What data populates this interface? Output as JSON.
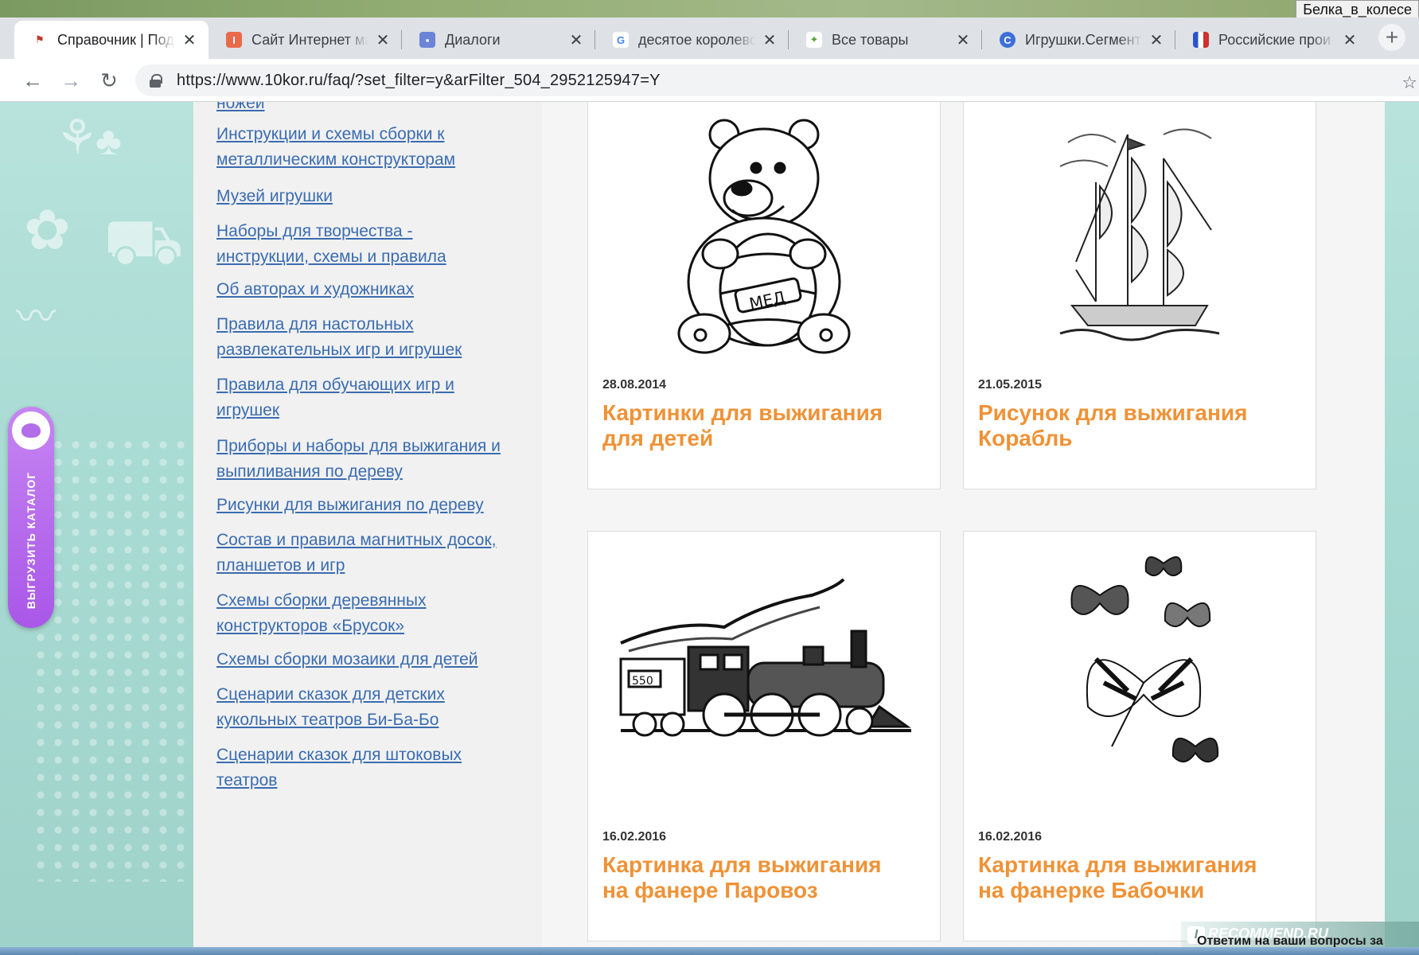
{
  "browser": {
    "user_badge": "Белка_в_колесе",
    "tabs": [
      {
        "title": "Справочник | Под",
        "active": true,
        "favicon_color": "#ffffff",
        "favicon_glyph": "⚑",
        "favicon_icon": "shield-icon"
      },
      {
        "title": "Сайт Интернет ма",
        "active": false,
        "favicon_color": "#e86a4a",
        "favicon_glyph": "I",
        "favicon_icon": "site-icon"
      },
      {
        "title": "Диалоги",
        "active": false,
        "favicon_color": "#6b84d8",
        "favicon_glyph": "▪",
        "favicon_icon": "chat-icon"
      },
      {
        "title": "десятое королевс",
        "active": false,
        "favicon_color": "#ffffff",
        "favicon_glyph": "G",
        "favicon_icon": "google-icon"
      },
      {
        "title": "Все товары",
        "active": false,
        "favicon_color": "#ffffff",
        "favicon_glyph": "✦",
        "favicon_icon": "leaf-icon"
      },
      {
        "title": "Игрушки.Сегмент",
        "active": false,
        "favicon_color": "#3f6fd8",
        "favicon_glyph": "C",
        "favicon_icon": "segment-icon"
      },
      {
        "title": "Российские прои",
        "active": false,
        "favicon_color": "#ffffff",
        "favicon_glyph": "▮",
        "favicon_icon": "bar-chart-icon"
      }
    ],
    "close_glyph": "✕",
    "new_tab_glyph": "+",
    "url": "https://www.10kor.ru/faq/?set_filter=y&arFilter_504_2952125947=Y",
    "back_glyph": "←",
    "forward_glyph": "→",
    "reload_glyph": "↻",
    "star_glyph": "☆"
  },
  "sidebar": {
    "cut_item": "ножей",
    "items": [
      {
        "line1": "Инструкции и схемы сборки к",
        "line2": "металлическим конструкторам"
      },
      {
        "line1": "Музей игрушки",
        "line2": ""
      },
      {
        "line1": "Наборы для творчества -",
        "line2": "инструкции, схемы и правила"
      },
      {
        "line1": "Об авторах и художниках",
        "line2": ""
      },
      {
        "line1": "Правила для настольных",
        "line2": "развлекательных игр и игрушек"
      },
      {
        "line1": "Правила для обучающих игр и",
        "line2": "игрушек"
      },
      {
        "line1": "Приборы и наборы для выжигания и",
        "line2": "выпиливания по дереву"
      },
      {
        "line1": "Рисунки для выжигания по дереву",
        "line2": ""
      },
      {
        "line1": "Состав и правила магнитных досок,",
        "line2": "планшетов и игр"
      },
      {
        "line1": "Схемы сборки деревянных",
        "line2": "конструкторов «Брусок»"
      },
      {
        "line1": "Схемы сборки мозаики для детей",
        "line2": ""
      },
      {
        "line1": "Сценарии сказок для детских",
        "line2": "кукольных театров Би-Ба-Бо"
      },
      {
        "line1": "Сценарии сказок для штоковых",
        "line2": "театров"
      }
    ]
  },
  "cards": [
    {
      "date": "28.08.2014",
      "title_line1": "Картинки для выжигания",
      "title_line2": "для детей",
      "image": "bear-with-honey-barrel",
      "barrel_text": "МЕД"
    },
    {
      "date": "21.05.2015",
      "title_line1": "Рисунок для выжигания",
      "title_line2": "Корабль",
      "image": "sailing-ship"
    },
    {
      "date": "16.02.2016",
      "title_line1": "Картинка для выжигания",
      "title_line2": "на фанере Паровоз",
      "image": "steam-locomotive",
      "loco_number": "550"
    },
    {
      "date": "16.02.2016",
      "title_line1": "Картинка для выжигания",
      "title_line2": "на фанерке Бабочки",
      "image": "butterflies"
    }
  ],
  "catalog_button": {
    "label": "ВЫГРУЗИТЬ КАТАЛОГ"
  },
  "watermark": {
    "text": "RECOMMEND.RU",
    "mark": "I"
  },
  "footer_note": "Ответим на ваши вопросы за",
  "colors": {
    "link": "#3a6cb0",
    "card_title": "#ef9236",
    "catalog": "#b36de9",
    "loader": "#1c34e0"
  }
}
